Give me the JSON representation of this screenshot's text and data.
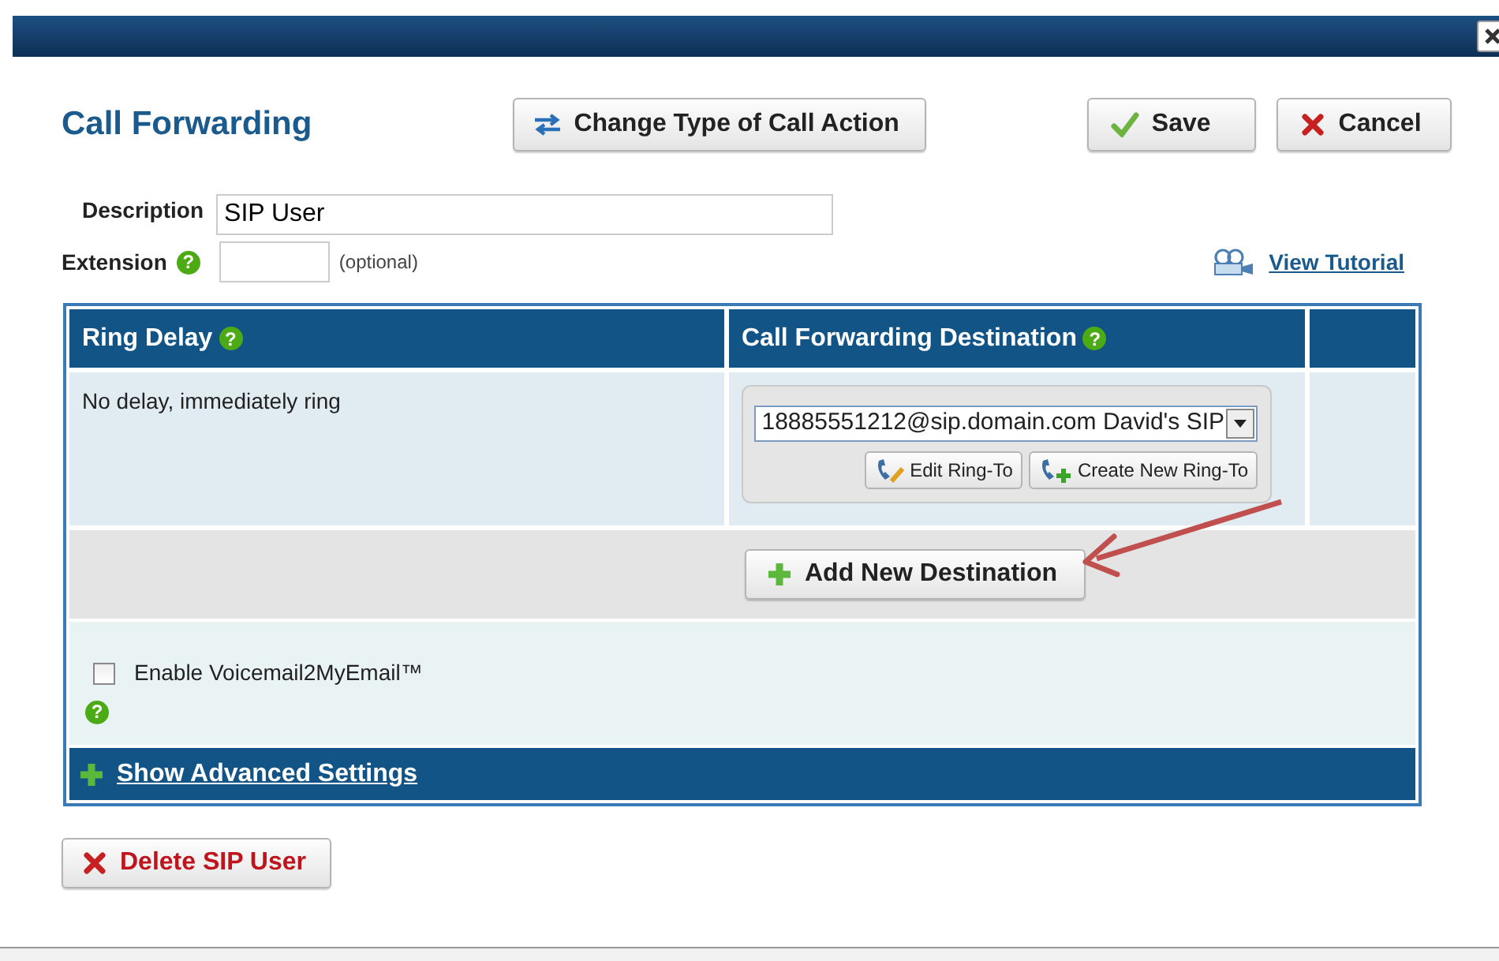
{
  "title": "Call Forwarding",
  "toolbar": [
    {
      "kind": "swap",
      "label": "Change Type of Call Action"
    },
    {
      "kind": "save",
      "label": "Save"
    },
    {
      "kind": "cancel",
      "label": "Cancel"
    }
  ],
  "description": {
    "label": "Description",
    "value": "SIP User"
  },
  "extension": {
    "label": "Extension",
    "help": "?",
    "hint": "(optional)"
  },
  "tutorial": {
    "label": "View Tutorial"
  },
  "table": {
    "columns": [
      {
        "label": "Ring Delay",
        "help": "?"
      },
      {
        "label": "Call Forwarding Destination",
        "help": "?"
      }
    ],
    "rows": [
      {
        "ring_delay": "No delay, immediately ring",
        "destination": "18885551212@sip.domain.com David's SIP",
        "buttons": [
          {
            "kind": "edit",
            "label": "Edit Ring-To"
          },
          {
            "kind": "create",
            "label": "Create New Ring-To"
          }
        ]
      }
    ],
    "add_button": "Add New Destination",
    "voicemail": {
      "label": "Enable Voicemail2MyEmail™",
      "checked": false,
      "help": "?"
    },
    "advanced": "Show Advanced Settings"
  },
  "delete_button": "Delete SIP User"
}
